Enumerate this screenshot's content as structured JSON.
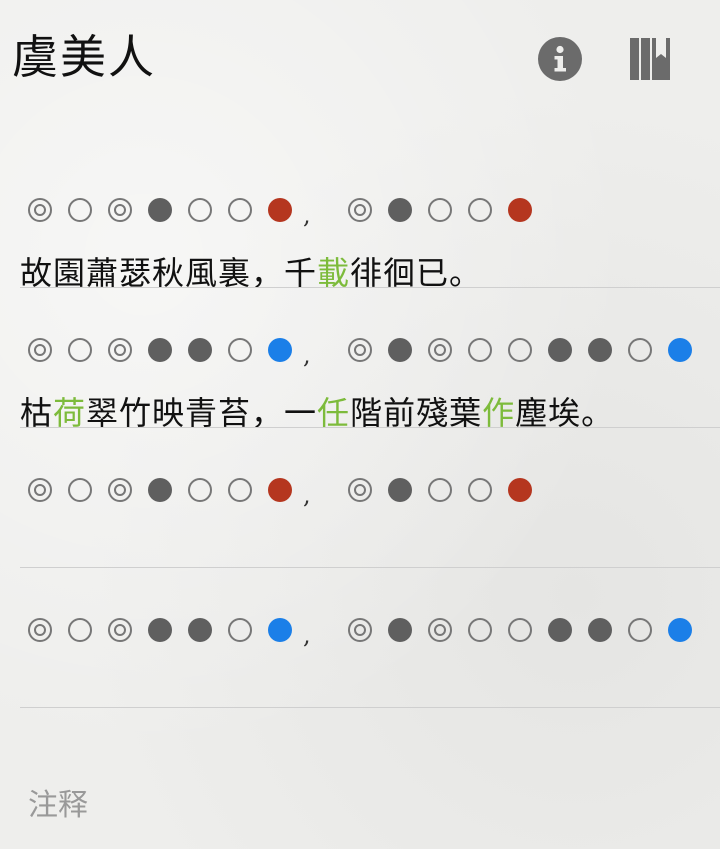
{
  "title": "虞美人",
  "header_icons": {
    "info": "info-icon",
    "library": "library-icon"
  },
  "colors": {
    "rhyme_red": "#b5361f",
    "rhyme_blue": "#1b7fe8",
    "highlight_green": "#7dbb3b"
  },
  "legend_marks": {
    "either": "◎",
    "level": "○",
    "oblique": "●"
  },
  "rows": [
    {
      "pattern_a": [
        "◎",
        "○",
        "◎",
        "●",
        "○",
        "○",
        "●"
      ],
      "pattern_a_end_color": "red",
      "separator": ",",
      "pattern_b": [
        "◎",
        "●",
        "○",
        "○",
        "●"
      ],
      "pattern_b_end_color": "red",
      "verse": [
        {
          "text": "故園蕭瑟秋風裏，千"
        },
        {
          "text": "載",
          "highlight": true
        },
        {
          "text": "徘徊已。"
        }
      ]
    },
    {
      "pattern_a": [
        "◎",
        "○",
        "◎",
        "●",
        "●",
        "○",
        "●"
      ],
      "pattern_a_end_color": "blue",
      "separator": ",",
      "pattern_b": [
        "◎",
        "●",
        "◎",
        "○",
        "○",
        "●",
        "●",
        "○",
        "●"
      ],
      "pattern_b_end_color": "blue",
      "verse": [
        {
          "text": "枯"
        },
        {
          "text": "荷",
          "highlight": true
        },
        {
          "text": "翠竹映青苔，一"
        },
        {
          "text": "任",
          "highlight": true
        },
        {
          "text": "階前殘葉"
        },
        {
          "text": "作",
          "highlight": true
        },
        {
          "text": "塵埃。"
        }
      ]
    },
    {
      "pattern_a": [
        "◎",
        "○",
        "◎",
        "●",
        "○",
        "○",
        "●"
      ],
      "pattern_a_end_color": "red",
      "separator": ",",
      "pattern_b": [
        "◎",
        "●",
        "○",
        "○",
        "●"
      ],
      "pattern_b_end_color": "red",
      "verse": []
    },
    {
      "pattern_a": [
        "◎",
        "○",
        "◎",
        "●",
        "●",
        "○",
        "●"
      ],
      "pattern_a_end_color": "blue",
      "separator": ",",
      "pattern_b": [
        "◎",
        "●",
        "◎",
        "○",
        "○",
        "●",
        "●",
        "○",
        "●"
      ],
      "pattern_b_end_color": "blue",
      "verse": []
    }
  ],
  "notes_label": "注释"
}
